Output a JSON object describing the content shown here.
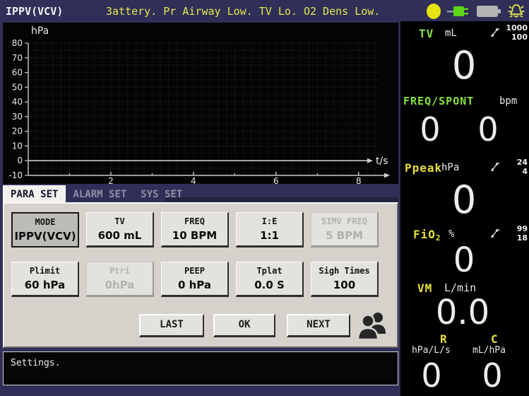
{
  "header": {
    "mode_title": "IPPV(VCV)",
    "alarm_message": "3attery. Pr Airway Low. TV Lo. O2 Dens Low.",
    "indicator_colors": {
      "status_circle": "#e6e312",
      "ac_power": "#5cd615",
      "battery": "#b5b5b5",
      "alarm_bell": "#e6e74e"
    }
  },
  "chart_data": {
    "type": "line",
    "title": "",
    "ylabel": "hPa",
    "xlabel": "t/s",
    "ylim": [
      -10,
      80
    ],
    "xlim": [
      0,
      8.5
    ],
    "yticks": [
      80,
      70,
      60,
      50,
      40,
      30,
      20,
      10,
      0,
      -10
    ],
    "xticks": [
      2,
      4,
      6,
      8
    ],
    "minor_xticks": [
      1,
      3,
      5,
      7
    ],
    "grid": true,
    "grid_step": {
      "x": 0.2,
      "y": 5
    },
    "zero_axis": true,
    "series": []
  },
  "tabs": [
    {
      "label": "PARA SET",
      "active": true
    },
    {
      "label": "ALARM SET",
      "active": false
    },
    {
      "label": "SYS SET",
      "active": false
    }
  ],
  "parameters": [
    {
      "label": "MODE",
      "value": "IPPV(VCV)",
      "state": "selected"
    },
    {
      "label": "TV",
      "value": "600 mL",
      "state": "normal"
    },
    {
      "label": "FREQ",
      "value": "10 BPM",
      "state": "normal"
    },
    {
      "label": "I:E",
      "value": "1:1",
      "state": "normal"
    },
    {
      "label": "SIMV FREQ",
      "value": "5 BPM",
      "state": "disabled"
    },
    {
      "label": "Plimit",
      "value": "60 hPa",
      "state": "normal"
    },
    {
      "label": "Ptri",
      "value": "0hPa",
      "state": "disabled"
    },
    {
      "label": "PEEP",
      "value": "0 hPa",
      "state": "normal"
    },
    {
      "label": "Tplat",
      "value": "0.0 S",
      "state": "normal"
    },
    {
      "label": "Sigh Times",
      "value": "100",
      "state": "normal"
    }
  ],
  "nav_buttons": {
    "last": "LAST",
    "ok": "OK",
    "next": "NEXT"
  },
  "status_bar": {
    "text": "Settings."
  },
  "monitors": [
    {
      "label": "TV",
      "unit": "mL",
      "limit_high": "1000",
      "limit_low": "100",
      "values": [
        "0"
      ]
    },
    {
      "label": "FREQ/SPONT",
      "unit": "bpm",
      "values": [
        "0",
        "0"
      ]
    },
    {
      "label": "Ppeak",
      "unit": "hPa",
      "limit_high": "24",
      "limit_low": "4",
      "values": [
        "0"
      ]
    },
    {
      "label": "FiO",
      "label_sub": "2",
      "unit": "%",
      "limit_high": "99",
      "limit_low": "18",
      "values": [
        "0"
      ]
    },
    {
      "label": "VM",
      "unit": "L/min",
      "values": [
        "0.0"
      ]
    },
    {
      "label": "R",
      "unit": "hPa/L/s",
      "values": [
        "0"
      ]
    },
    {
      "label": "C",
      "unit": "mL/hPa",
      "values": [
        "0"
      ]
    }
  ],
  "colors": {
    "background": "#2f2f58",
    "panel_gray": "#d5d2cc",
    "label_green": "#86e23c",
    "label_yellow": "#e8df3a",
    "alarm_yellow": "#e6e74e"
  }
}
